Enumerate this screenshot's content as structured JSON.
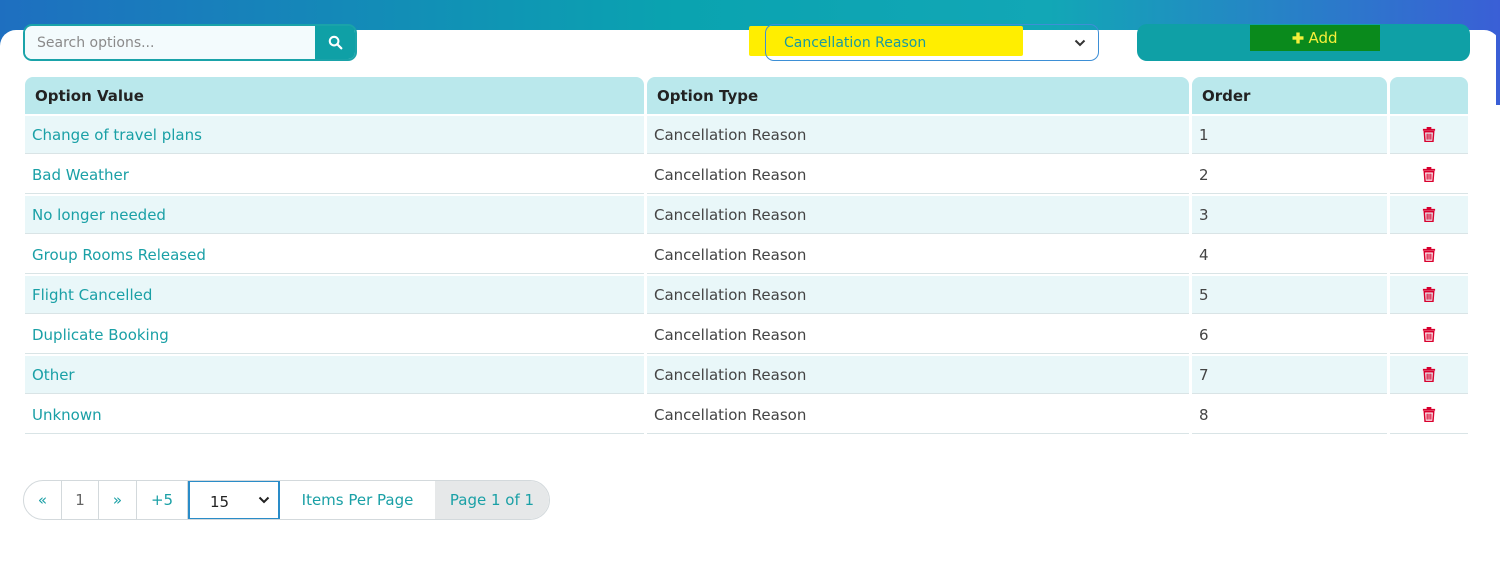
{
  "search": {
    "placeholder": "Search options..."
  },
  "type_filter": {
    "selected": "Cancellation Reason"
  },
  "add_button": {
    "label": "Add"
  },
  "table": {
    "headers": [
      "Option Value",
      "Option Type",
      "Order",
      ""
    ],
    "rows": [
      {
        "value": "Change of travel plans",
        "type": "Cancellation Reason",
        "order": "1"
      },
      {
        "value": "Bad Weather",
        "type": "Cancellation Reason",
        "order": "2"
      },
      {
        "value": "No longer needed",
        "type": "Cancellation Reason",
        "order": "3"
      },
      {
        "value": "Group Rooms Released",
        "type": "Cancellation Reason",
        "order": "4"
      },
      {
        "value": "Flight Cancelled",
        "type": "Cancellation Reason",
        "order": "5"
      },
      {
        "value": "Duplicate Booking",
        "type": "Cancellation Reason",
        "order": "6"
      },
      {
        "value": "Other",
        "type": "Cancellation Reason",
        "order": "7"
      },
      {
        "value": "Unknown",
        "type": "Cancellation Reason",
        "order": "8"
      }
    ]
  },
  "pagination": {
    "prev": "«",
    "page": "1",
    "next": "»",
    "jump": "+5",
    "page_size": "15",
    "items_per_page_label": "Items Per Page",
    "page_info": "Page 1 of 1"
  },
  "colors": {
    "accent": "#0fa0a6",
    "header_bg": "#bae8ec",
    "row_alt_bg": "#e9f7f9",
    "delete": "#d9002e",
    "highlight_yellow": "#ffee00",
    "add_highlight_green": "#0a8a1c"
  },
  "icons": {
    "search": "search-icon",
    "add": "plus-icon",
    "delete": "trash-icon",
    "dropdown": "chevron-down-icon"
  }
}
